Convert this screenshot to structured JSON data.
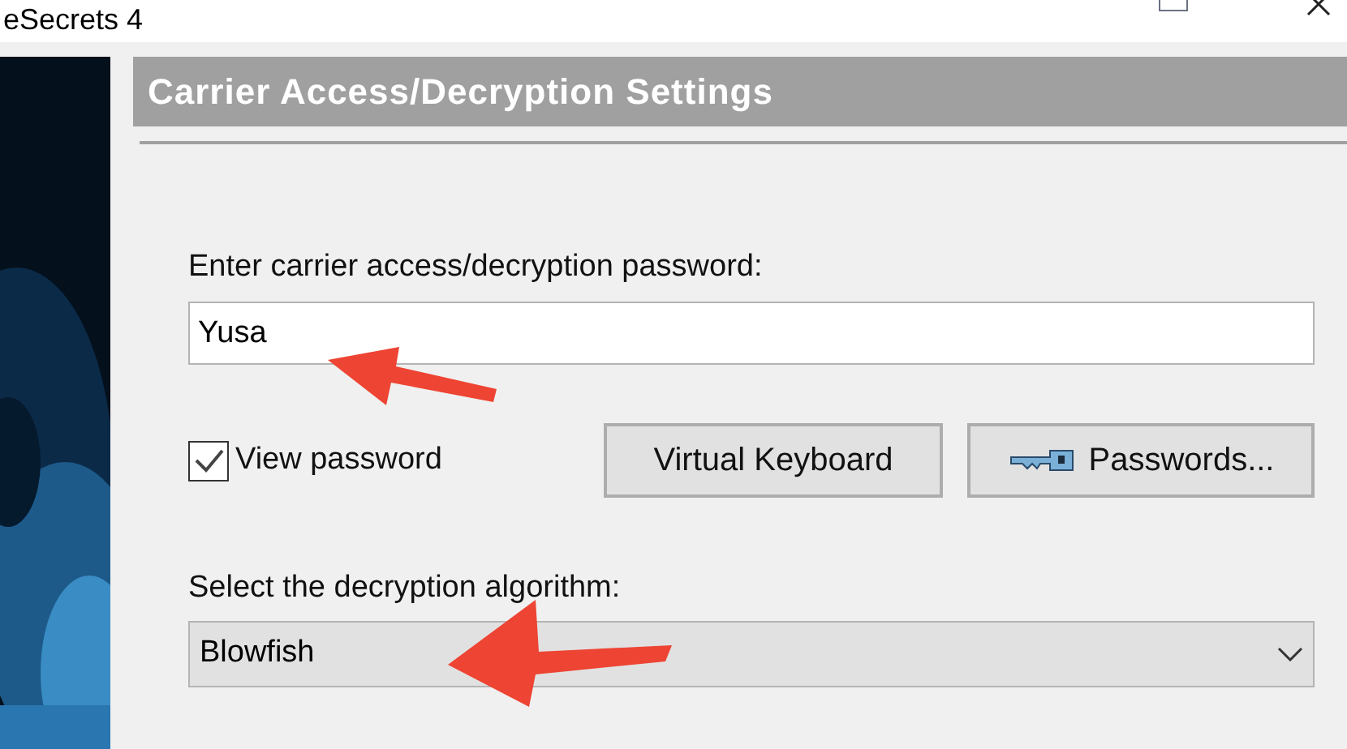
{
  "window": {
    "title": "eSecrets 4"
  },
  "panel": {
    "title": "Carrier Access/Decryption Settings"
  },
  "password": {
    "label": "Enter carrier access/decryption password:",
    "value": "Yusa"
  },
  "view_password": {
    "label": "View password",
    "checked": true
  },
  "buttons": [
    {
      "kind": "plain",
      "label": "Virtual Keyboard"
    },
    {
      "kind": "key",
      "label": "Passwords..."
    }
  ],
  "algorithm": {
    "label": "Select the decryption algorithm:",
    "value": "Blowfish"
  }
}
